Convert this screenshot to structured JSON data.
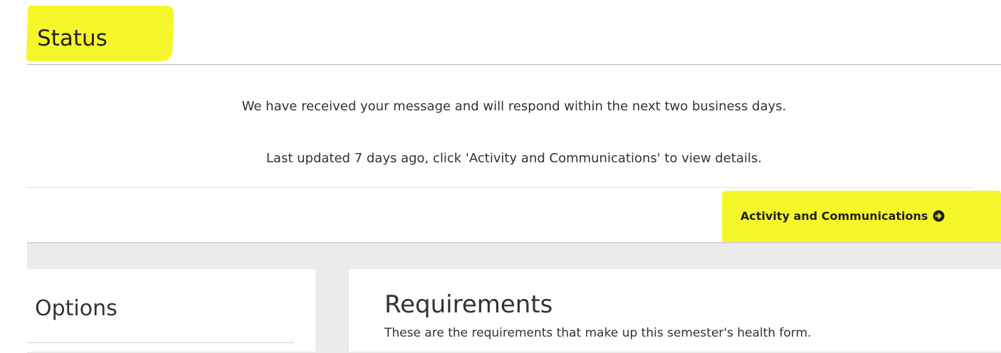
{
  "status": {
    "title": "Status",
    "message": "We have received your message and will respond within the next two business days.",
    "last_updated": "Last updated 7 days ago, click 'Activity and Communications' to view details."
  },
  "activity_link": {
    "label": "Activity and Communications",
    "icon": "circle-arrow-right-icon"
  },
  "options": {
    "title": "Options"
  },
  "requirements": {
    "title": "Requirements",
    "description": "These are the requirements that make up this semester's health form."
  },
  "colors": {
    "highlight": "#f6f72a",
    "text": "#333333",
    "panel_background": "#ececec"
  }
}
